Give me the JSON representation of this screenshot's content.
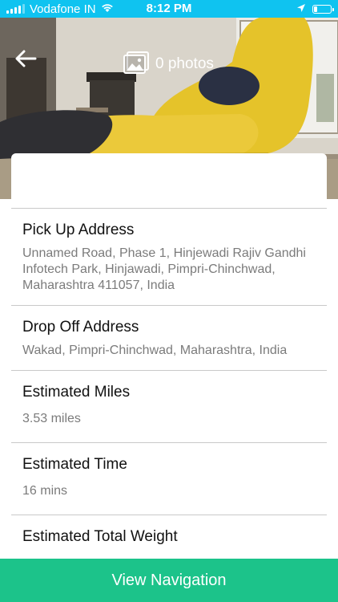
{
  "status_bar": {
    "carrier": "Vodafone IN",
    "time": "8:12 PM",
    "battery_level": 0.2,
    "wifi_icon": "wifi-icon",
    "location_icon": "location-arrow-icon",
    "battery_icon": "battery-icon"
  },
  "header": {
    "back_icon": "back-arrow-icon",
    "photo_icon": "photos-icon",
    "photo_count": "0 photos"
  },
  "details": {
    "pickup": {
      "label": "Pick Up Address",
      "value": "Unnamed Road, Phase 1, Hinjewadi Rajiv Gandhi Infotech Park, Hinjawadi, Pimpri-Chinchwad, Maharashtra 411057, India"
    },
    "dropoff": {
      "label": "Drop Off Address",
      "value": "Wakad, Pimpri-Chinchwad, Maharashtra, India"
    },
    "miles": {
      "label": "Estimated Miles",
      "value": "3.53 miles"
    },
    "time": {
      "label": "Estimated Time",
      "value": "16 mins"
    },
    "weight": {
      "label": "Estimated Total Weight"
    }
  },
  "actions": {
    "view_navigation": "View Navigation"
  },
  "colors": {
    "status_bar": "#0fc3f0",
    "button": "#1cc38a",
    "chair": "#e5c32a"
  }
}
